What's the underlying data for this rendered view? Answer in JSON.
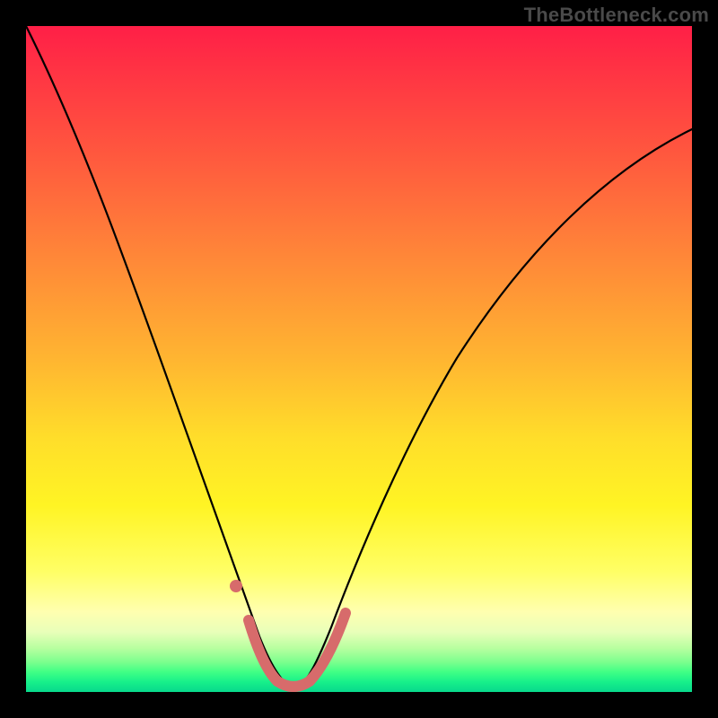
{
  "watermark": "TheBottleneck.com",
  "chart_data": {
    "type": "line",
    "title": "",
    "xlabel": "",
    "ylabel": "",
    "xlim": [
      0,
      100
    ],
    "ylim": [
      0,
      100
    ],
    "grid": false,
    "legend": false,
    "series": [
      {
        "name": "curve",
        "x": [
          0,
          3,
          6,
          9,
          12,
          15,
          18,
          21,
          24,
          27,
          30,
          32,
          34,
          36,
          38,
          40,
          42,
          44,
          46,
          50,
          55,
          60,
          65,
          70,
          75,
          80,
          85,
          90,
          95,
          100
        ],
        "y": [
          100,
          92,
          84,
          76,
          68,
          60,
          52,
          44,
          36,
          28,
          20,
          14,
          9,
          5,
          2,
          0.7,
          2,
          5,
          10,
          20,
          31,
          41,
          49,
          56,
          62,
          67,
          71,
          74.5,
          77,
          79
        ]
      }
    ],
    "highlight_segments": [
      {
        "name": "bottom-flat",
        "x": [
          34,
          44
        ],
        "y": [
          8,
          8
        ]
      },
      {
        "name": "left-dot",
        "x": [
          31.5
        ],
        "y": [
          16
        ]
      }
    ],
    "gradient_stops": [
      {
        "pos": 0.0,
        "color": "#ff1f47"
      },
      {
        "pos": 0.35,
        "color": "#ff8838"
      },
      {
        "pos": 0.62,
        "color": "#ffde2a"
      },
      {
        "pos": 0.88,
        "color": "#ffffb0"
      },
      {
        "pos": 0.97,
        "color": "#40ff85"
      },
      {
        "pos": 1.0,
        "color": "#08d98c"
      }
    ]
  }
}
